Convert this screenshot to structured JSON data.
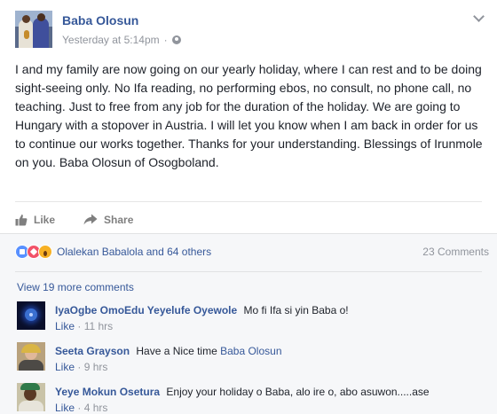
{
  "post": {
    "author": "Baba Olosun",
    "timestamp": "Yesterday at 5:14pm",
    "separator": "·",
    "body": "I and my family are now going on our yearly holiday, where I can rest and to be doing sight-seeing only. No Ifa reading, no performing ebos, no consult, no phone call, no teaching. Just to free from any job for the duration of the holiday. We are going to Hungary with a stopover in Austria. I will let you know when I am back in order for us to continue our works together. Thanks for your understanding. Blessings of Irunmole on you. Baba Olosun of Osogboland."
  },
  "actions": {
    "like_label": "Like",
    "share_label": "Share"
  },
  "reactions": {
    "names": "Olalekan Babalola and 64 others",
    "comments_count": "23 Comments",
    "icons": [
      "like-icon",
      "love-icon",
      "wow-icon"
    ]
  },
  "comments_section": {
    "view_more": "View 19 more comments",
    "comments": [
      {
        "author": "IyaOgbe OmoEdu Yeyelufe Oyewole",
        "text": "Mo fi Ifa si yin Baba o!",
        "mention": "",
        "like": "Like",
        "sep": "·",
        "time": "11 hrs"
      },
      {
        "author": "Seeta Grayson",
        "text": "Have a Nice time",
        "mention": "Baba Olosun",
        "like": "Like",
        "sep": "·",
        "time": "9 hrs"
      },
      {
        "author": "Yeye Mokun Osetura",
        "text": "Enjoy your holiday o Baba, alo ire o, abo asuwon.....ase",
        "mention": "",
        "like": "Like",
        "sep": "·",
        "time": "4 hrs"
      }
    ]
  },
  "colors": {
    "link": "#365899",
    "meta": "#90949c",
    "text": "#1d2129",
    "feedback_bg": "#f6f7f9"
  }
}
